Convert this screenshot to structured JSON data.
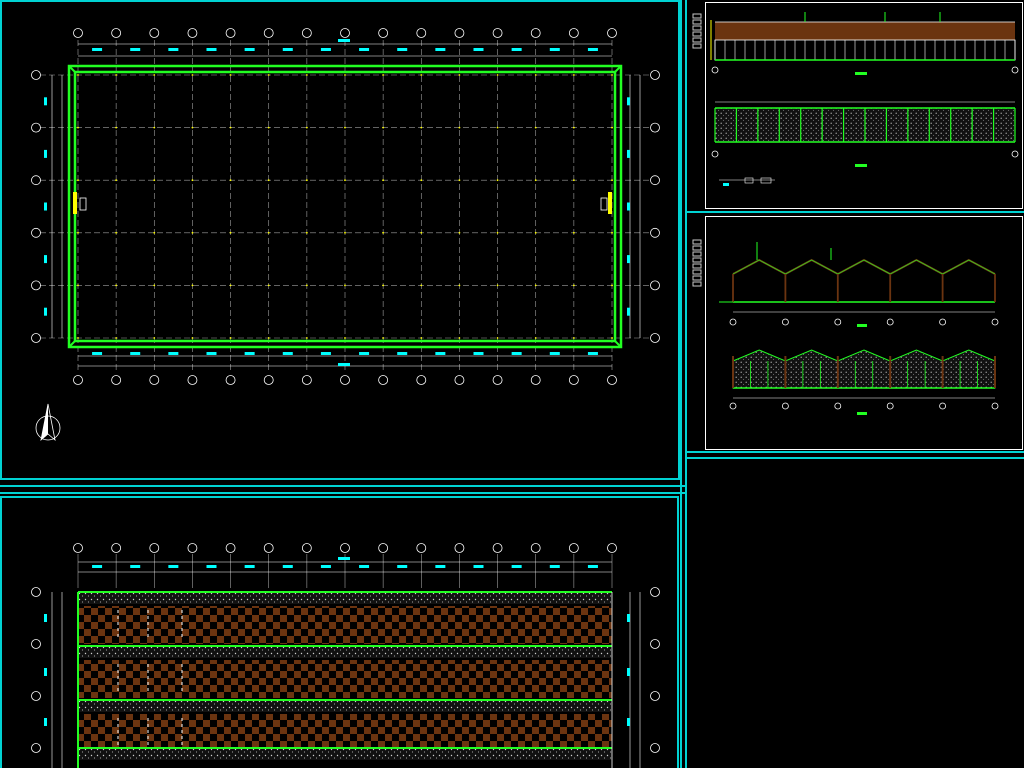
{
  "colors": {
    "background": "#000000",
    "frame_cyan": "#00d2d2",
    "sheet_border": "#ffffff",
    "wall_green": "#22ff22",
    "grid_gray": "#a0a0a0",
    "dim_cyan": "#00ffff",
    "brown": "#6b3410",
    "yellow": "#ffff00",
    "white": "#ffffff"
  },
  "plan": {
    "bubble_count_x": 15,
    "bubble_count_y": 6,
    "bay_count_x": 14,
    "bay_count_y": 5
  },
  "icons": {
    "north_arrow": "north-arrow-icon",
    "axis_bubble": "axis-bubble-icon"
  },
  "elevation_spans": 5
}
